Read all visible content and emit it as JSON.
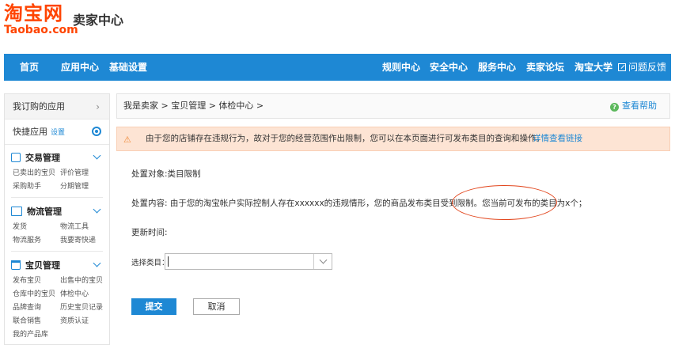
{
  "header": {
    "logo_cn": "淘宝网",
    "logo_en": "Taobao.com",
    "title": "卖家中心"
  },
  "nav": {
    "left": [
      "首页",
      "应用中心",
      "基础设置"
    ],
    "right": [
      "规则中心",
      "安全中心",
      "服务中心",
      "卖家论坛",
      "淘宝大学"
    ],
    "feedback": "问题反馈"
  },
  "sidebar": {
    "subscribed": "我订购的应用",
    "quick": "快捷应用",
    "settings": "设置",
    "groups": [
      {
        "title": "交易管理",
        "links": [
          "已卖出的宝贝",
          "评价管理",
          "采购助手",
          "分期管理"
        ]
      },
      {
        "title": "物流管理",
        "links": [
          "发货",
          "物流工具",
          "物流服务",
          "我要寄快递"
        ]
      },
      {
        "title": "宝贝管理",
        "links": [
          "发布宝贝",
          "出售中的宝贝",
          "仓库中的宝贝",
          "体检中心",
          "品牌查询",
          "历史宝贝记录",
          "联合销售",
          "资质认证",
          "我的产品库"
        ]
      }
    ]
  },
  "main": {
    "breadcrumb": "我是卖家 > 宝贝管理 > 体检中心 >",
    "help": "查看帮助",
    "alert": {
      "text": "由于您的店铺存在违规行为，故对于您的经营范围作出限制，您可以在本页面进行可发布类目的查询和操作。",
      "link": "详情查看链接"
    },
    "target": "处置对象:类目限制",
    "content": "处置内容: 由于您的淘宝帐户实际控制人存在xxxxxx的违规情形，您的商品发布类目受到限制。您当前可发布的类目为x个；",
    "update_time": "更新时间:",
    "select_label": "选择类目：",
    "select_value": "",
    "submit": "提交",
    "cancel": "取消"
  },
  "colors": {
    "brand": "#ff4400",
    "nav": "#1e88d4",
    "alert_bg": "#fde4d4",
    "highlight": "#e2461d"
  }
}
